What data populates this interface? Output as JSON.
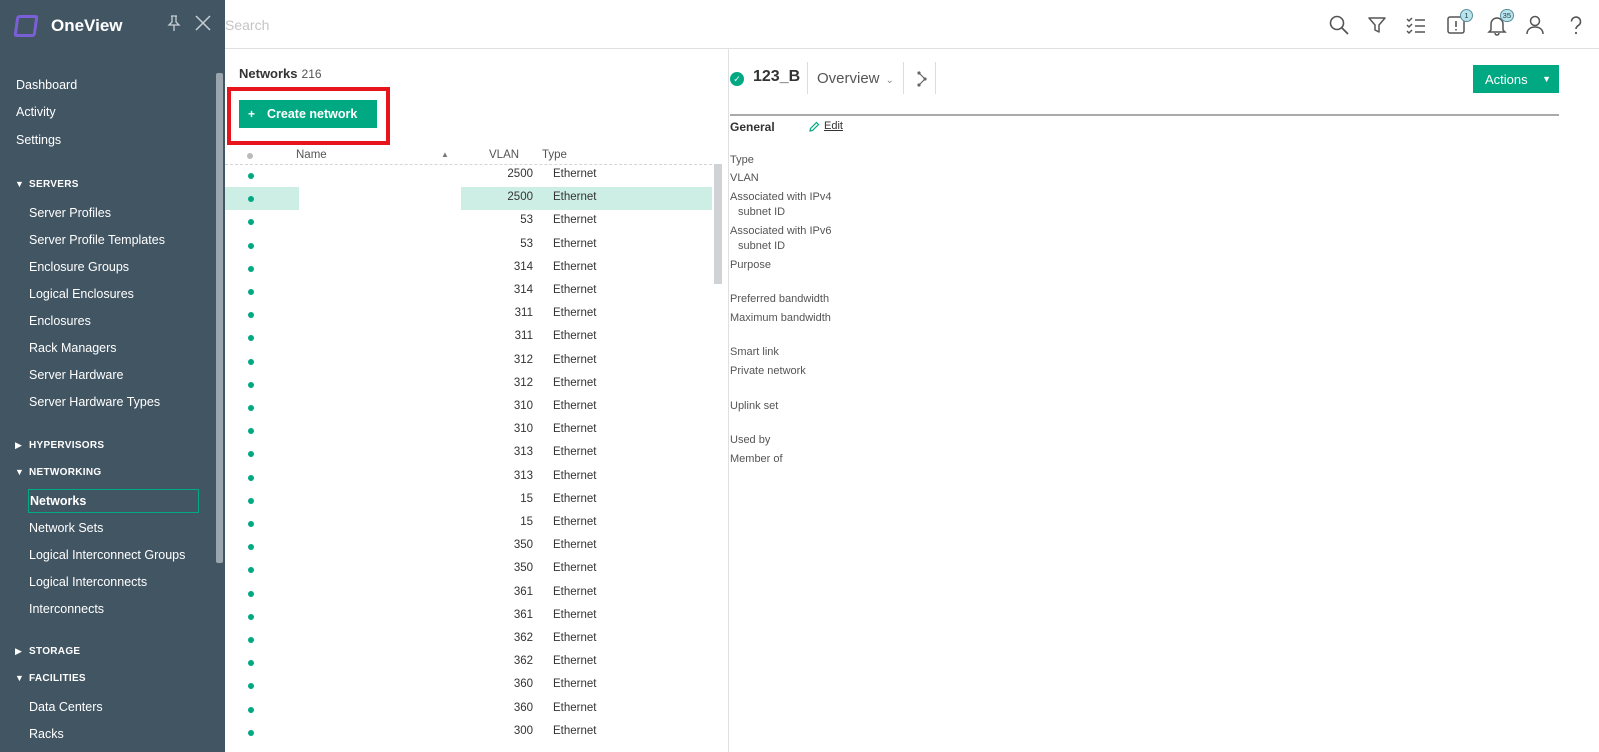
{
  "brand": {
    "name": "OneView"
  },
  "search": {
    "placeholder": "Search"
  },
  "notifications": {
    "alerts_badge": "1",
    "bell_badge": "35"
  },
  "sidebar": {
    "top_items": [
      "Dashboard",
      "Activity",
      "Settings"
    ],
    "sections": {
      "servers": "SERVERS",
      "hypervisors": "HYPERVISORS",
      "networking": "NETWORKING",
      "storage": "STORAGE",
      "facilities": "FACILITIES"
    },
    "servers_items": [
      "Server Profiles",
      "Server Profile Templates",
      "Enclosure Groups",
      "Logical Enclosures",
      "Enclosures",
      "Rack Managers",
      "Server Hardware",
      "Server Hardware Types"
    ],
    "networking_items": [
      "Networks",
      "Network Sets",
      "Logical Interconnect Groups",
      "Logical Interconnects",
      "Interconnects"
    ],
    "facilities_items": [
      "Data Centers",
      "Racks"
    ],
    "active_item": "Networks"
  },
  "list": {
    "title": "Networks",
    "count": "216",
    "create_label": "Create network",
    "columns": {
      "name": "Name",
      "vlan": "VLAN",
      "type": "Type"
    },
    "rows": [
      {
        "vlan": "2500",
        "type": "Ethernet"
      },
      {
        "vlan": "2500",
        "type": "Ethernet"
      },
      {
        "vlan": "53",
        "type": "Ethernet"
      },
      {
        "vlan": "53",
        "type": "Ethernet"
      },
      {
        "vlan": "314",
        "type": "Ethernet"
      },
      {
        "vlan": "314",
        "type": "Ethernet"
      },
      {
        "vlan": "311",
        "type": "Ethernet"
      },
      {
        "vlan": "311",
        "type": "Ethernet"
      },
      {
        "vlan": "312",
        "type": "Ethernet"
      },
      {
        "vlan": "312",
        "type": "Ethernet"
      },
      {
        "vlan": "310",
        "type": "Ethernet"
      },
      {
        "vlan": "310",
        "type": "Ethernet"
      },
      {
        "vlan": "313",
        "type": "Ethernet"
      },
      {
        "vlan": "313",
        "type": "Ethernet"
      },
      {
        "vlan": "15",
        "type": "Ethernet"
      },
      {
        "vlan": "15",
        "type": "Ethernet"
      },
      {
        "vlan": "350",
        "type": "Ethernet"
      },
      {
        "vlan": "350",
        "type": "Ethernet"
      },
      {
        "vlan": "361",
        "type": "Ethernet"
      },
      {
        "vlan": "361",
        "type": "Ethernet"
      },
      {
        "vlan": "362",
        "type": "Ethernet"
      },
      {
        "vlan": "362",
        "type": "Ethernet"
      },
      {
        "vlan": "360",
        "type": "Ethernet"
      },
      {
        "vlan": "360",
        "type": "Ethernet"
      },
      {
        "vlan": "300",
        "type": "Ethernet"
      }
    ]
  },
  "detail": {
    "name": "123_B",
    "view": "Overview",
    "actions_label": "Actions",
    "section": "General",
    "edit_label": "Edit",
    "fields": {
      "type": "Type",
      "vlan": "VLAN",
      "ipv4_a": "Associated with IPv4",
      "ipv4_b": "subnet ID",
      "ipv6_a": "Associated with IPv6",
      "ipv6_b": "subnet ID",
      "purpose": "Purpose",
      "preferred_bw": "Preferred bandwidth",
      "maximum_bw": "Maximum bandwidth",
      "smart_link": "Smart link",
      "private_network": "Private network",
      "uplink_set": "Uplink set",
      "used_by": "Used by",
      "member_of": "Member of"
    }
  },
  "colors": {
    "sidebar_bg": "#425563",
    "accent": "#01a982",
    "highlight": "#e8141c",
    "selected_row": "#cdeee5"
  }
}
